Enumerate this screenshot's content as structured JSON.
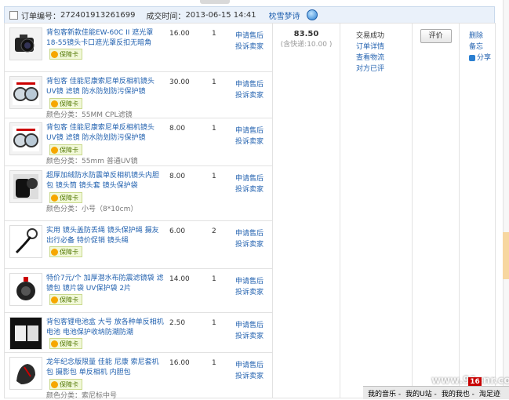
{
  "order": {
    "number_label": "订单编号：",
    "number": "272401913261699",
    "time_label": "成交时间：",
    "time": "2013-06-15 14:41",
    "seller": "枕雪梦诗"
  },
  "badge_label": "保障卡",
  "items": [
    {
      "title": "背包客新款佳能EW-60C II 遮光罩 18-55镜头卡口遮光罩反扣无暗角",
      "variant": "",
      "price": "16.00",
      "qty": "1",
      "link1": "申请售后",
      "link2": "投诉卖家",
      "image": "camera-with-lens-hood"
    },
    {
      "title": "背包客 佳能尼康索尼单反相机镜头UV镜 滤镜 防水防划防污保护镜",
      "variant": "颜色分类：55MM CPL滤镜",
      "price": "30.00",
      "qty": "1",
      "link1": "申请售后",
      "link2": "投诉卖家",
      "image": "filter-lenses"
    },
    {
      "title": "背包客 佳能尼康索尼单反相机镜头UV镜 滤镜 防水防划防污保护镜",
      "variant": "颜色分类：55mm 普通UV镜",
      "price": "8.00",
      "qty": "1",
      "link1": "申请售后",
      "link2": "投诉卖家",
      "image": "filter-lenses"
    },
    {
      "title": "超厚加绒防水防震单反相机镜头内胆包 镜头筒 镜头套 镜头保护袋",
      "variant": "颜色分类：小号（8*10cm）",
      "price": "8.00",
      "qty": "1",
      "link1": "申请售后",
      "link2": "投诉卖家",
      "image": "lens-pouch"
    },
    {
      "title": "实用 镜头盖防丢绳 镜头保护绳 摄友出行必备 特价促销 镜头绳",
      "variant": "",
      "price": "6.00",
      "qty": "2",
      "link1": "申请售后",
      "link2": "投诉卖家",
      "image": "lens-cap-string"
    },
    {
      "title": "特价7元/个 加厚潜水布防震滤镜袋 滤镜包 镜片袋 UV保护袋 2片",
      "variant": "",
      "price": "14.00",
      "qty": "1",
      "link1": "申请售后",
      "link2": "投诉卖家",
      "image": "filter-pouch"
    },
    {
      "title": "背包客锂电池盒 大号 放各种单反相机电池 电池保护收纳防潮防潮",
      "variant": "",
      "price": "2.50",
      "qty": "1",
      "link1": "申请售后",
      "link2": "投诉卖家",
      "image": "battery-box"
    },
    {
      "title": "龙年纪念版限量 佳能 尼康 索尼套机包 摄影包 单反相机 内胆包",
      "variant": "颜色分类：索尼标中号",
      "price": "16.00",
      "qty": "1",
      "link1": "申请售后",
      "link2": "投诉卖家",
      "image": "camera-bag"
    }
  ],
  "total": {
    "amount": "83.50",
    "shipping": "(含快递:10.00 )"
  },
  "status": {
    "state": "交易成功",
    "detail": "订单详情",
    "logistics": "查看物流",
    "evaluation": "对方已评"
  },
  "eval_button": "评价",
  "ops": {
    "delete": "删除",
    "note": "备忘",
    "share": "分享"
  },
  "taskbar": {
    "items": [
      "我的音乐 -",
      "我的U站 -",
      "我的我也 -",
      "淘足迹"
    ],
    "notification": "16"
  },
  "watermark": "www.91cnr.com"
}
